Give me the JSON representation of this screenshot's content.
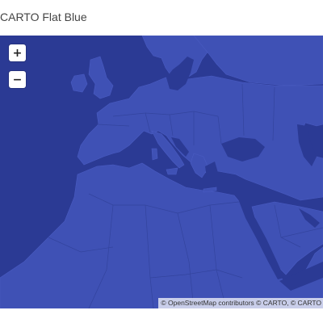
{
  "title": "CARTO Flat Blue",
  "map": {
    "style": "CARTO Flat Blue",
    "colors": {
      "water": "#2b3a94",
      "land": "#3f51b5",
      "borders": "#33449e",
      "coast": "#4a5cc2"
    },
    "controls": {
      "zoom_in_label": "+",
      "zoom_out_label": "−"
    },
    "attribution": "© OpenStreetMap contributors © CARTO, © CARTO"
  }
}
